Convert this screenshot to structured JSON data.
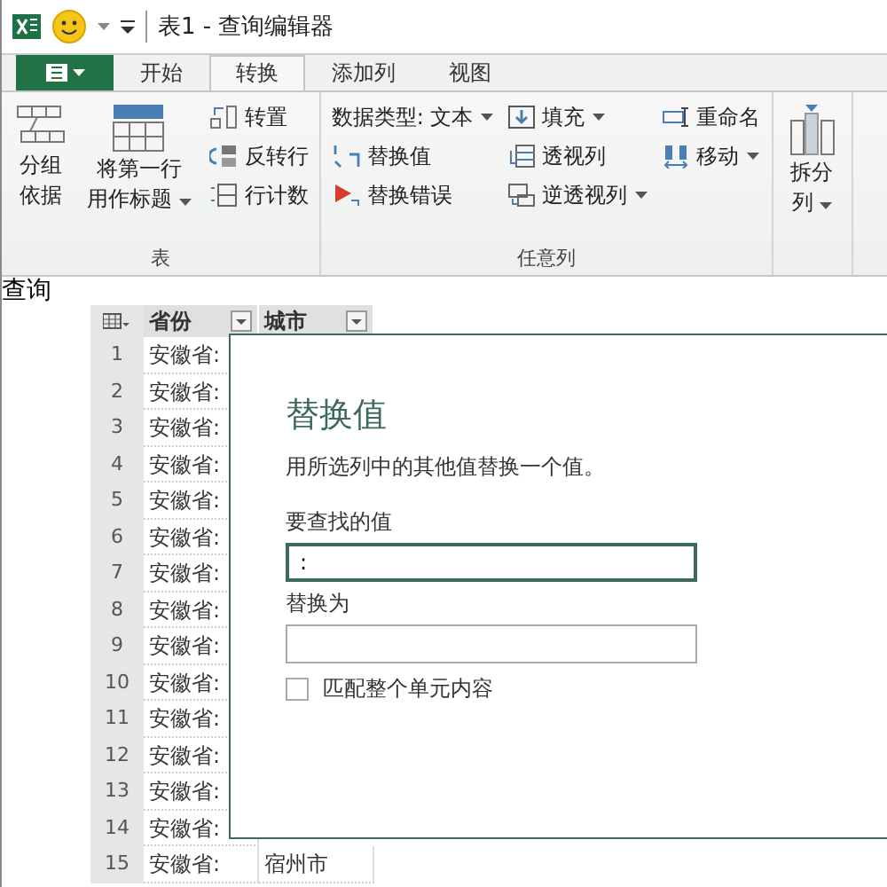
{
  "window": {
    "title": "表1 - 查询编辑器"
  },
  "tabs": [
    {
      "label": "开始",
      "selected": false
    },
    {
      "label": "转换",
      "selected": true
    },
    {
      "label": "添加列",
      "selected": false
    },
    {
      "label": "视图",
      "selected": false
    }
  ],
  "ribbon": [
    {
      "label": "表",
      "columns": [
        [
          {
            "kind": "large",
            "lines": [
              "分组",
              "依据"
            ],
            "dropdown": false
          }
        ],
        [
          {
            "kind": "large",
            "lines": [
              "将第一行",
              "用作标题"
            ],
            "dropdown": true
          }
        ],
        [
          {
            "kind": "small",
            "label": "转置",
            "dropdown": false
          },
          {
            "kind": "small",
            "label": "反转行",
            "dropdown": false
          },
          {
            "kind": "small",
            "label": "行计数",
            "dropdown": false
          }
        ]
      ]
    },
    {
      "label": "任意列",
      "columns": [
        [
          {
            "kind": "small",
            "label": "数据类型: 文本",
            "dropdown": true
          },
          {
            "kind": "small",
            "label": "替换值",
            "dropdown": false
          },
          {
            "kind": "small",
            "label": "替换错误",
            "dropdown": false
          }
        ],
        [
          {
            "kind": "small",
            "label": "填充",
            "dropdown": true
          },
          {
            "kind": "small",
            "label": "透视列",
            "dropdown": false
          },
          {
            "kind": "small",
            "label": "逆透视列",
            "dropdown": true
          }
        ],
        [
          {
            "kind": "small",
            "label": "重命名",
            "dropdown": false
          },
          {
            "kind": "small",
            "label": "移动",
            "dropdown": true
          }
        ]
      ]
    },
    {
      "columns": [
        [
          {
            "kind": "large",
            "lines": [
              "拆分",
              "列"
            ],
            "dropdown": true
          }
        ]
      ]
    }
  ],
  "queries_label": "查询",
  "grid": {
    "columns": [
      {
        "label": "省份"
      },
      {
        "label": "城市"
      }
    ],
    "rows": [
      {
        "num": "1",
        "cells": [
          "安徽省:"
        ]
      },
      {
        "num": "2",
        "cells": [
          "安徽省:"
        ]
      },
      {
        "num": "3",
        "cells": [
          "安徽省:"
        ]
      },
      {
        "num": "4",
        "cells": [
          "安徽省:"
        ]
      },
      {
        "num": "5",
        "cells": [
          "安徽省:"
        ]
      },
      {
        "num": "6",
        "cells": [
          "安徽省:"
        ]
      },
      {
        "num": "7",
        "cells": [
          "安徽省:"
        ]
      },
      {
        "num": "8",
        "cells": [
          "安徽省:"
        ]
      },
      {
        "num": "9",
        "cells": [
          "安徽省:"
        ]
      },
      {
        "num": "10",
        "cells": [
          "安徽省:"
        ]
      },
      {
        "num": "11",
        "cells": [
          "安徽省:"
        ]
      },
      {
        "num": "12",
        "cells": [
          "安徽省:"
        ]
      },
      {
        "num": "13",
        "cells": [
          "安徽省:"
        ]
      },
      {
        "num": "14",
        "cells": [
          "安徽省:"
        ]
      },
      {
        "num": "15",
        "cells": [
          "安徽省:",
          "宿州市"
        ]
      }
    ]
  },
  "dialog": {
    "title": "替换值",
    "description": "用所选列中的其他值替换一个值。",
    "fields": [
      {
        "label": "要查找的值",
        "value": ":",
        "focused": true
      },
      {
        "label": "替换为",
        "focused": false
      }
    ],
    "checkbox": {
      "label": "匹配整个单元内容",
      "checked": false
    }
  }
}
